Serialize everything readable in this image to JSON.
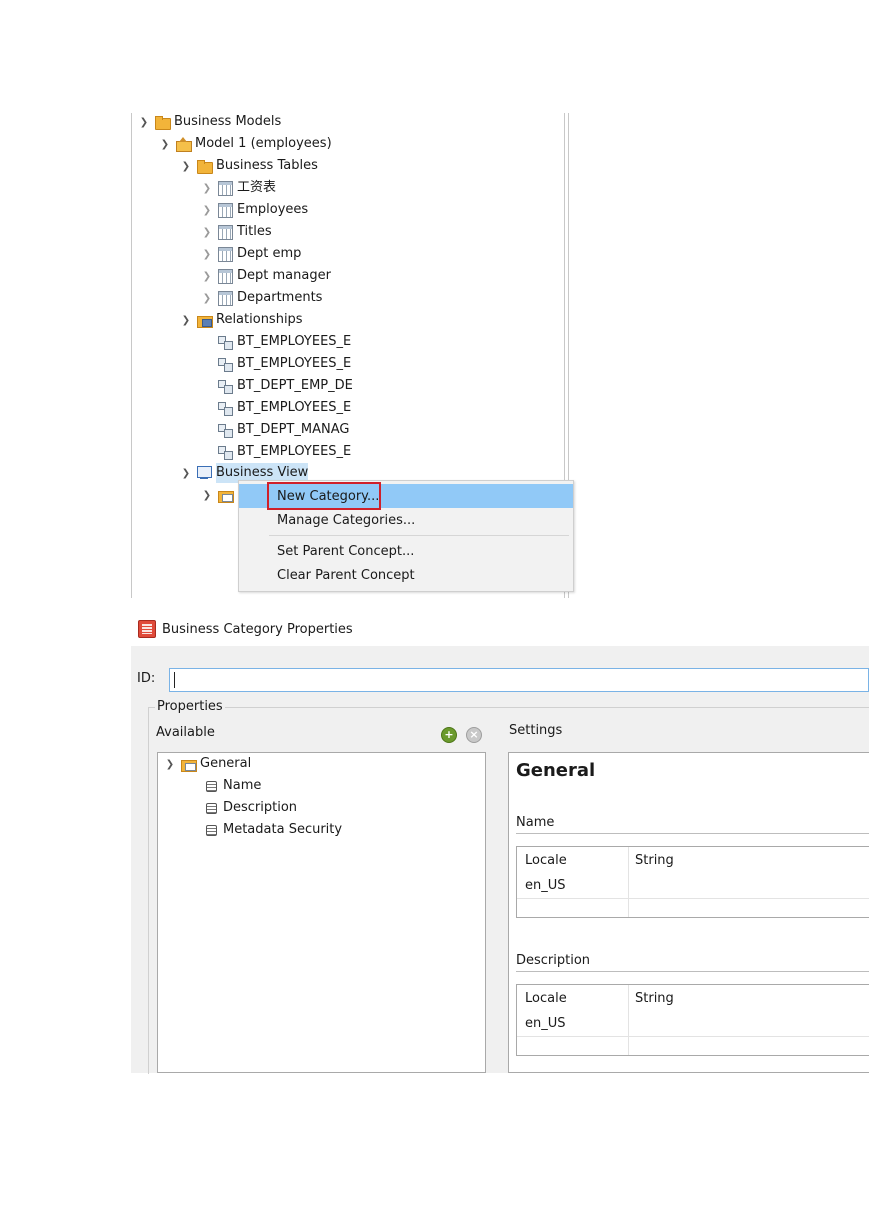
{
  "tree": {
    "items": [
      {
        "label": "Business Models"
      },
      {
        "label": "Model 1 (employees)"
      },
      {
        "label": "Business Tables"
      },
      {
        "label": "工资表"
      },
      {
        "label": "Employees"
      },
      {
        "label": "Titles"
      },
      {
        "label": "Dept emp"
      },
      {
        "label": "Dept manager"
      },
      {
        "label": "Departments"
      },
      {
        "label": "Relationships"
      },
      {
        "label": "BT_EMPLOYEES_E"
      },
      {
        "label": "BT_EMPLOYEES_E"
      },
      {
        "label": "BT_DEPT_EMP_DE"
      },
      {
        "label": "BT_EMPLOYEES_E"
      },
      {
        "label": "BT_DEPT_MANAG"
      },
      {
        "label": "BT_EMPLOYEES_E"
      },
      {
        "label": "Business View"
      }
    ]
  },
  "context_menu": {
    "items": [
      {
        "label": "New Category..."
      },
      {
        "label": "Manage Categories..."
      },
      {
        "label": "Set Parent Concept..."
      },
      {
        "label": "Clear Parent Concept"
      }
    ]
  },
  "dialog": {
    "title": "Business Category Properties",
    "id_label": "ID:",
    "id_value": "",
    "properties_label": "Properties",
    "available_label": "Available",
    "add_symbol": "+",
    "remove_symbol": "×",
    "available_tree": [
      {
        "label": "General"
      },
      {
        "label": "Name"
      },
      {
        "label": "Description"
      },
      {
        "label": "Metadata Security"
      }
    ],
    "settings_label": "Settings",
    "settings_heading": "General",
    "name_section": {
      "label": "Name",
      "col_locale": "Locale",
      "col_string": "String",
      "row_locale": "en_US"
    },
    "description_section": {
      "label": "Description",
      "col_locale": "Locale",
      "col_string": "String",
      "row_locale": "en_US"
    }
  }
}
